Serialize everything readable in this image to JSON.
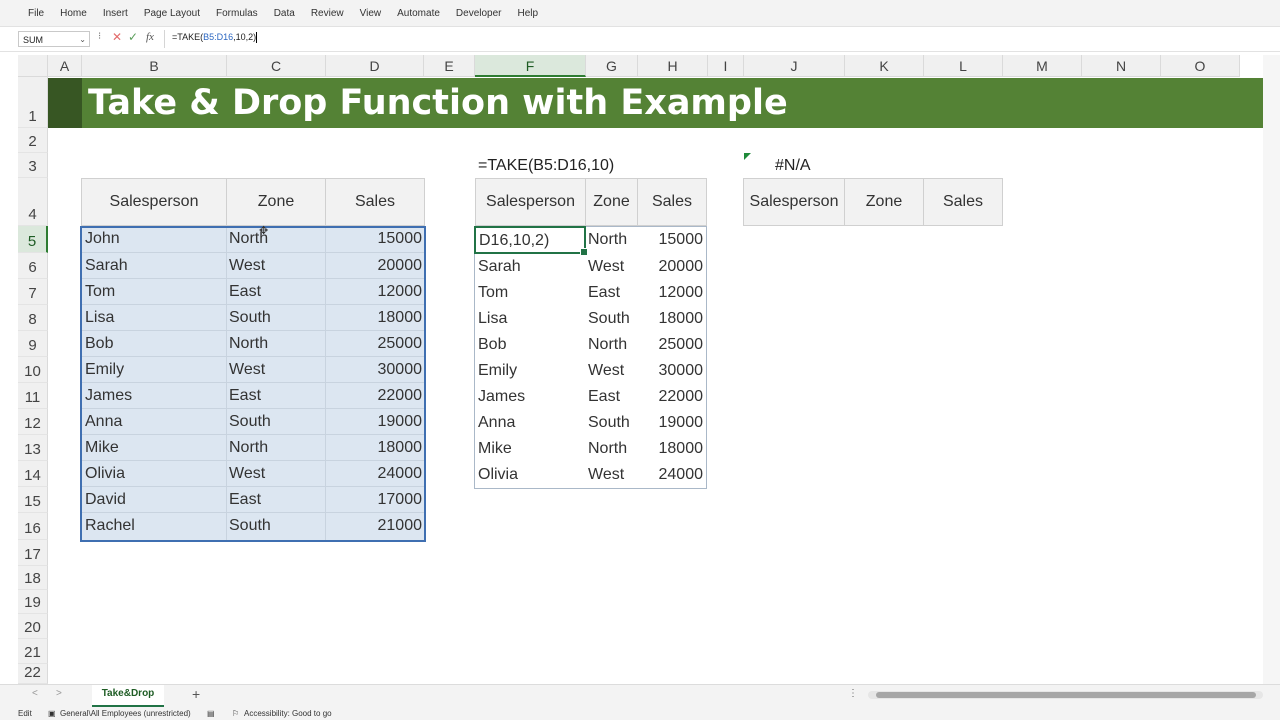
{
  "menu": [
    "File",
    "Home",
    "Insert",
    "Page Layout",
    "Formulas",
    "Data",
    "Review",
    "View",
    "Automate",
    "Developer",
    "Help"
  ],
  "formula_bar": {
    "name_box": "SUM",
    "formula_prefix": "=TAKE(",
    "formula_ref": "B5:D16",
    "formula_suffix": ",10,2)",
    "fx_label": "fx"
  },
  "columns": [
    "A",
    "B",
    "C",
    "D",
    "E",
    "F",
    "G",
    "H",
    "I",
    "J",
    "K",
    "L",
    "M",
    "N",
    "O"
  ],
  "rows": [
    "1",
    "2",
    "3",
    "4",
    "5",
    "6",
    "7",
    "8",
    "9",
    "10",
    "11",
    "12",
    "13",
    "14",
    "15",
    "16",
    "17",
    "18",
    "19",
    "20",
    "21",
    "22"
  ],
  "title": "Take & Drop Function with Example",
  "headers": [
    "Salesperson",
    "Zone",
    "Sales"
  ],
  "source_table": [
    [
      "John",
      "North",
      "15000"
    ],
    [
      "Sarah",
      "West",
      "20000"
    ],
    [
      "Tom",
      "East",
      "12000"
    ],
    [
      "Lisa",
      "South",
      "18000"
    ],
    [
      "Bob",
      "North",
      "25000"
    ],
    [
      "Emily",
      "West",
      "30000"
    ],
    [
      "James",
      "East",
      "22000"
    ],
    [
      "Anna",
      "South",
      "19000"
    ],
    [
      "Mike",
      "North",
      "18000"
    ],
    [
      "Olivia",
      "West",
      "24000"
    ],
    [
      "David",
      "East",
      "17000"
    ],
    [
      "Rachel",
      "South",
      "21000"
    ]
  ],
  "take_label": "=TAKE(B5:D16,10)",
  "take_editing_text": "D16,10,2)",
  "take_table": [
    [
      "",
      "North",
      "15000"
    ],
    [
      "Sarah",
      "West",
      "20000"
    ],
    [
      "Tom",
      "East",
      "12000"
    ],
    [
      "Lisa",
      "South",
      "18000"
    ],
    [
      "Bob",
      "North",
      "25000"
    ],
    [
      "Emily",
      "West",
      "30000"
    ],
    [
      "James",
      "East",
      "22000"
    ],
    [
      "Anna",
      "South",
      "19000"
    ],
    [
      "Mike",
      "North",
      "18000"
    ],
    [
      "Olivia",
      "West",
      "24000"
    ]
  ],
  "error_value": "#N/A",
  "sheet_tab": "Take&Drop",
  "status": {
    "mode": "Edit",
    "sensitivity": "General\\All Employees (unrestricted)",
    "accessibility": "Accessibility: Good to go"
  }
}
